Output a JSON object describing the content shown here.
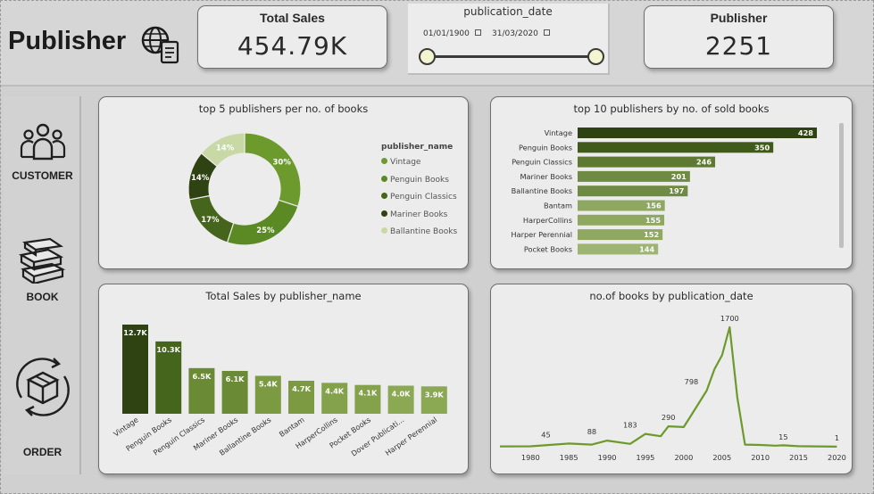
{
  "header": {
    "title": "Publisher"
  },
  "kpis": [
    {
      "label": "Total Sales",
      "value": "454.79K"
    },
    {
      "label": "Publisher",
      "value": "2251"
    }
  ],
  "slicer": {
    "title": "publication_date",
    "start": "01/01/1900",
    "end": "31/03/2020"
  },
  "nav": [
    {
      "label": "CUSTOMER",
      "icon": "people-icon"
    },
    {
      "label": "BOOK",
      "icon": "books-icon"
    },
    {
      "label": "ORDER",
      "icon": "order-box-icon"
    }
  ],
  "colors": {
    "darkest": "#2f4212",
    "dark": "#3f5a1a",
    "mid": "#5b7f26",
    "green": "#6d9a2c",
    "light": "#8dad58",
    "pale": "#c8d9a6"
  },
  "chart_data": [
    {
      "type": "pie",
      "title": "top 5 publishers per no. of books",
      "legend_title": "publisher_name",
      "legend_position": "right",
      "categories": [
        "Vintage",
        "Penguin Books",
        "Penguin Classics",
        "Mariner Books",
        "Ballantine Books"
      ],
      "values": [
        30,
        25,
        17,
        14,
        14
      ],
      "labels": [
        "30%",
        "25%",
        "17%",
        "14%",
        "14%"
      ],
      "colors": [
        "#6d9a2c",
        "#5b8a24",
        "#45641c",
        "#2f4212",
        "#c8d9a6"
      ]
    },
    {
      "type": "bar",
      "orientation": "horizontal",
      "title": "top 10 publishers by no. of sold books",
      "categories": [
        "Vintage",
        "Penguin Books",
        "Penguin Classics",
        "Mariner Books",
        "Ballantine Books",
        "Bantam",
        "HarperCollins",
        "Harper Perennial",
        "Pocket Books"
      ],
      "values": [
        428,
        350,
        246,
        201,
        197,
        156,
        155,
        152,
        144
      ],
      "colors": [
        "#2f4212",
        "#3f5a1a",
        "#5e7a32",
        "#6f8a42",
        "#6f8a42",
        "#8ea862",
        "#8ea862",
        "#8ea862",
        "#9db472"
      ]
    },
    {
      "type": "bar",
      "title": "Total Sales by publisher_name",
      "categories": [
        "Vintage",
        "Penguin Books",
        "Penguin Classics",
        "Mariner Books",
        "Ballantine Books",
        "Bantam",
        "HarperCollins",
        "Pocket Books",
        "Dover Publicati...",
        "Harper Perennial"
      ],
      "values": [
        12.7,
        10.3,
        6.5,
        6.1,
        5.4,
        4.7,
        4.4,
        4.1,
        4.0,
        3.9
      ],
      "labels": [
        "12.7K",
        "10.3K",
        "6.5K",
        "6.1K",
        "5.4K",
        "4.7K",
        "4.4K",
        "4.1K",
        "4.0K",
        "3.9K"
      ],
      "colors": [
        "#2f4212",
        "#45641c",
        "#6b8a35",
        "#6b8a35",
        "#7b9a42",
        "#7b9a42",
        "#84a14c",
        "#84a14c",
        "#8ba853",
        "#8ba853"
      ]
    },
    {
      "type": "line",
      "title": "no.of books by publication_date",
      "x": [
        1976,
        1980,
        1985,
        1988,
        1990,
        1993,
        1995,
        1997,
        1998,
        2000,
        2001,
        2003,
        2004,
        2005,
        2006,
        2007,
        2008,
        2010,
        2012,
        2013,
        2015,
        2020
      ],
      "y": [
        5,
        6,
        45,
        30,
        88,
        40,
        183,
        150,
        290,
        280,
        450,
        798,
        1100,
        1300,
        1700,
        700,
        30,
        25,
        15,
        20,
        8,
        1
      ],
      "point_labels": [
        {
          "x": 1982,
          "y": 45,
          "text": "45"
        },
        {
          "x": 1988,
          "y": 88,
          "text": "88"
        },
        {
          "x": 1993,
          "y": 183,
          "text": "183"
        },
        {
          "x": 1998,
          "y": 290,
          "text": "290"
        },
        {
          "x": 2001,
          "y": 798,
          "text": "798"
        },
        {
          "x": 2006,
          "y": 1700,
          "text": "1700"
        },
        {
          "x": 2013,
          "y": 15,
          "text": "15"
        },
        {
          "x": 2020,
          "y": 1,
          "text": "1"
        }
      ],
      "xticks": [
        1980,
        1985,
        1990,
        1995,
        2000,
        2005,
        2010,
        2015,
        2020
      ],
      "xlim": [
        1976,
        2021
      ],
      "ylim": [
        0,
        1800
      ]
    }
  ]
}
